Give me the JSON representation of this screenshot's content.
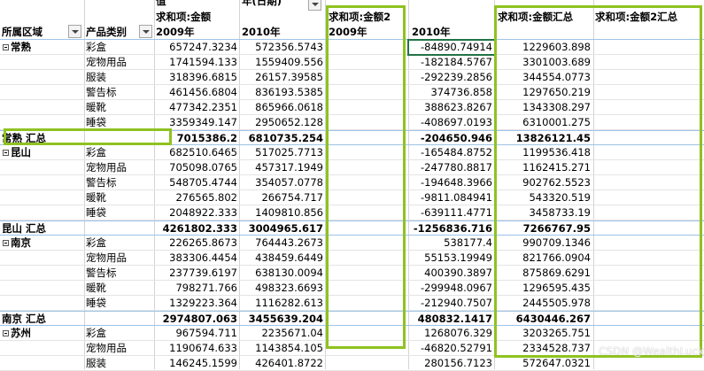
{
  "headers": {
    "top_val": "值",
    "top_date": "年(日期)",
    "sum_amount": "求和项:金额",
    "sum_amount2": "求和项:金额2",
    "region": "所属区域",
    "category": "产品类别",
    "y2009": "2009年",
    "y2010": "2010年",
    "y2009_b": "2009年",
    "y2010_b": "2010年",
    "sum_total": "求和项:金额汇总",
    "sum2_total": "求和项:金额2汇总"
  },
  "rows": [
    {
      "region": "常熟",
      "cat": "彩盒",
      "v09": "657247.3234",
      "v10": "572356.5743",
      "b10": "-84890.74914",
      "tot": "1229603.898"
    },
    {
      "cat": "宠物用品",
      "v09": "1741594.133",
      "v10": "1559409.556",
      "b10": "-182184.5767",
      "tot": "3301003.689"
    },
    {
      "cat": "服装",
      "v09": "318396.6815",
      "v10": "26157.39585",
      "b10": "-292239.2856",
      "tot": "344554.0773"
    },
    {
      "cat": "警告标",
      "v09": "461456.6804",
      "v10": "836193.5385",
      "b10": "374736.858",
      "tot": "1297650.219"
    },
    {
      "cat": "暖靴",
      "v09": "477342.2351",
      "v10": "865966.0618",
      "b10": "388623.8267",
      "tot": "1343308.297"
    },
    {
      "cat": "睡袋",
      "v09": "3359349.147",
      "v10": "2950652.128",
      "b10": "-408697.0193",
      "tot": "6310001.275"
    },
    {
      "total": "常熟 汇总",
      "v09": "7015386.2",
      "v10": "6810735.254",
      "b10": "-204650.946",
      "tot": "13826121.45"
    },
    {
      "region": "昆山",
      "cat": "彩盒",
      "v09": "682510.6465",
      "v10": "517025.7713",
      "b10": "-165484.8752",
      "tot": "1199536.418"
    },
    {
      "cat": "宠物用品",
      "v09": "705098.0765",
      "v10": "457317.1949",
      "b10": "-247780.8817",
      "tot": "1162415.271"
    },
    {
      "cat": "警告标",
      "v09": "548705.4744",
      "v10": "354057.0778",
      "b10": "-194648.3966",
      "tot": "902762.5523"
    },
    {
      "cat": "暖靴",
      "v09": "276565.802",
      "v10": "266754.717",
      "b10": "-9811.084941",
      "tot": "543320.519"
    },
    {
      "cat": "睡袋",
      "v09": "2048922.333",
      "v10": "1409810.856",
      "b10": "-639111.4771",
      "tot": "3458733.19"
    },
    {
      "total": "昆山 汇总",
      "v09": "4261802.333",
      "v10": "3004965.617",
      "b10": "-1256836.716",
      "tot": "7266767.95"
    },
    {
      "region": "南京",
      "cat": "彩盒",
      "v09": "226265.8673",
      "v10": "764443.2673",
      "b10": "538177.4",
      "tot": "990709.1346"
    },
    {
      "cat": "宠物用品",
      "v09": "383306.4454",
      "v10": "438459.6449",
      "b10": "55153.19949",
      "tot": "821766.0904"
    },
    {
      "cat": "警告标",
      "v09": "237739.6197",
      "v10": "638130.0094",
      "b10": "400390.3897",
      "tot": "875869.6291"
    },
    {
      "cat": "暖靴",
      "v09": "798271.766",
      "v10": "498323.6693",
      "b10": "-299948.0967",
      "tot": "1296595.435"
    },
    {
      "cat": "睡袋",
      "v09": "1329223.364",
      "v10": "1116282.613",
      "b10": "-212940.7507",
      "tot": "2445505.978"
    },
    {
      "total": "南京 汇总",
      "v09": "2974807.063",
      "v10": "3455639.204",
      "b10": "480832.1417",
      "tot": "6430446.267"
    },
    {
      "region": "苏州",
      "cat": "彩盒",
      "v09": "967594.711",
      "v10": "2235671.04",
      "b10": "1268076.329",
      "tot": "3203265.751"
    },
    {
      "cat": "宠物用品",
      "v09": "1190674.633",
      "v10": "1143854.105",
      "b10": "-46820.52791",
      "tot": "2334528.737"
    },
    {
      "cat": "服装",
      "v09": "146245.1599",
      "v10": "426401.8722",
      "b10": "280156.7123",
      "tot": "572647.0321"
    }
  ],
  "watermark": "CSDN @WealthLucky"
}
